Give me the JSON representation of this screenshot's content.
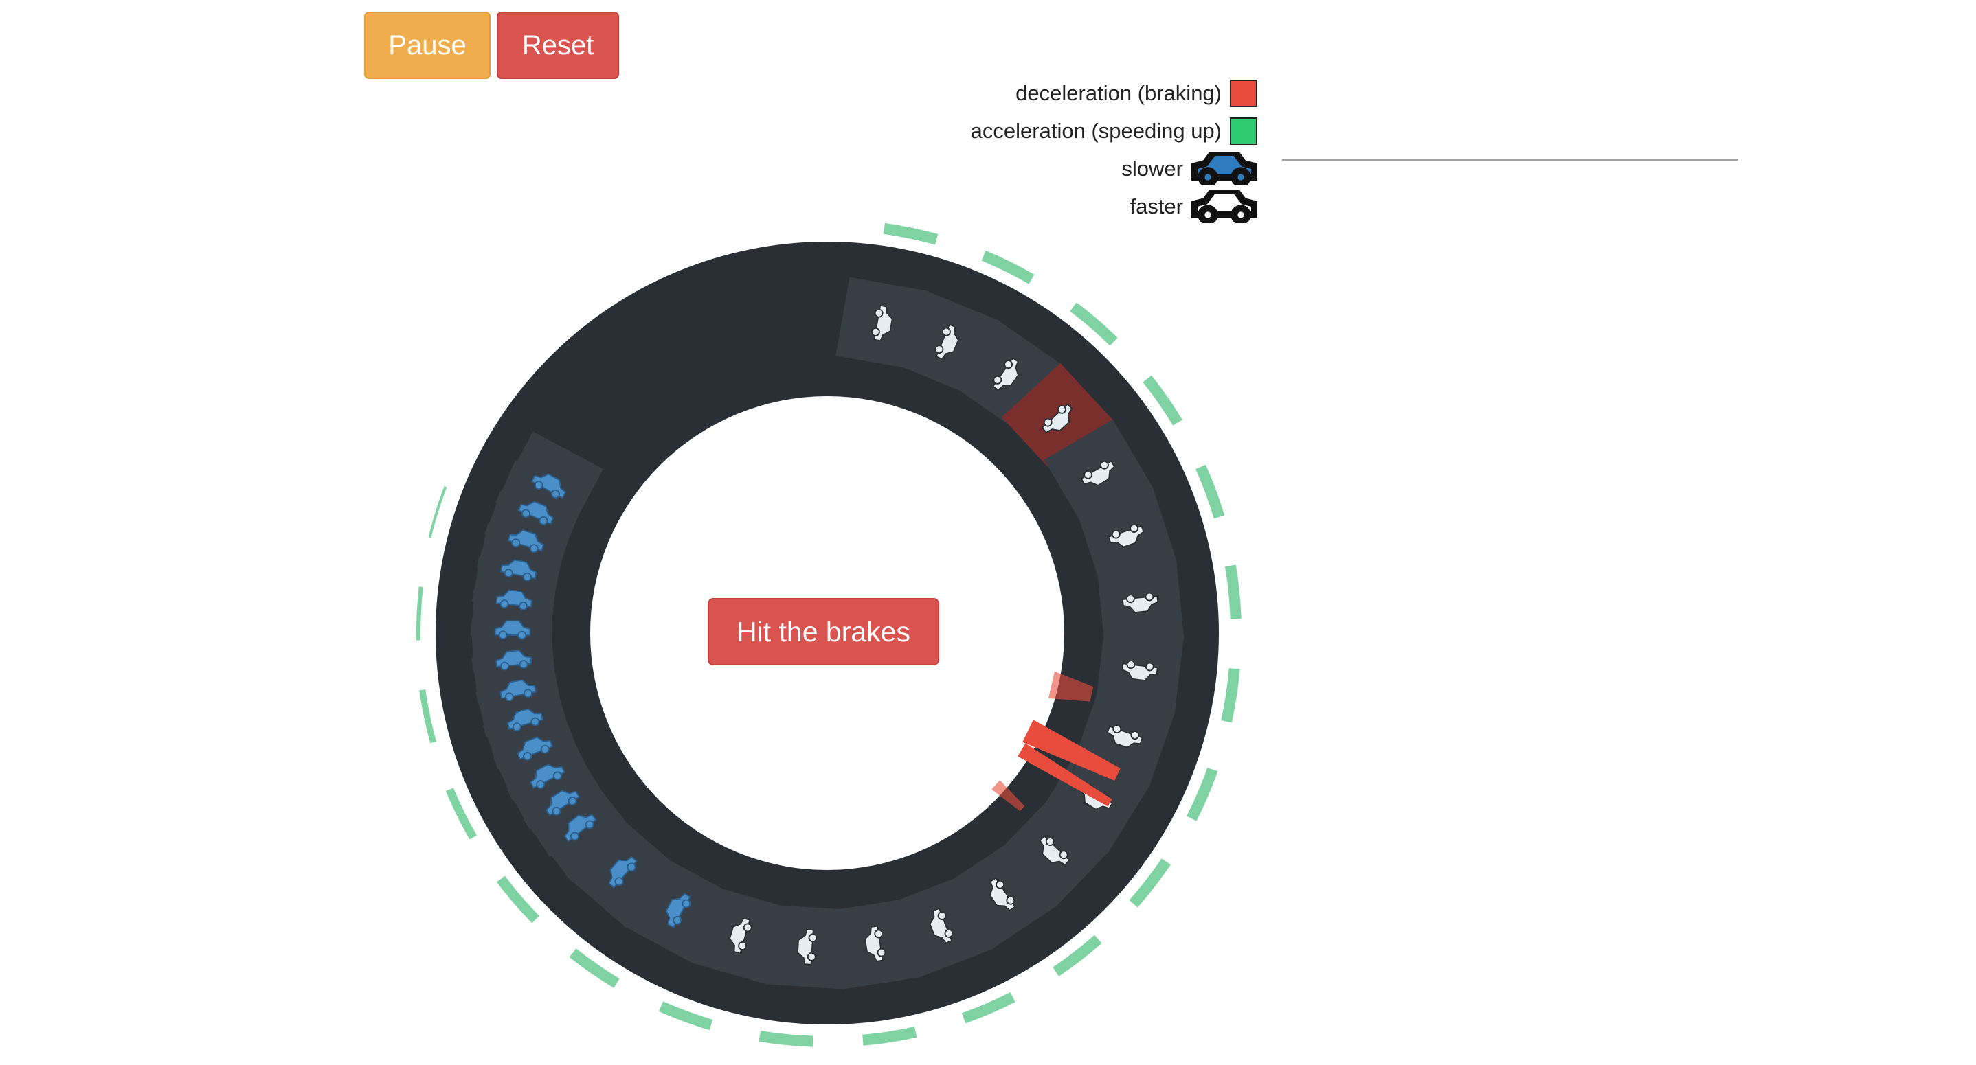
{
  "controls": {
    "pause_label": "Pause",
    "reset_label": "Reset",
    "brakes_label": "Hit the brakes"
  },
  "legend": {
    "deceleration_label": "deceleration (braking)",
    "acceleration_label": "acceleration (speeding up)",
    "slower_label": "slower",
    "faster_label": "faster"
  },
  "colors": {
    "deceleration": "#e74c3c",
    "acceleration": "#2ecc71",
    "slower_car": "#2f7bbf",
    "faster_car": "#ffffff",
    "road": "#2a2f35",
    "cell": "#3a4047",
    "braking_cell": "#7b2f2c"
  },
  "icons": {
    "slower": "car-icon",
    "faster": "car-icon",
    "track_car": "car-icon"
  }
}
